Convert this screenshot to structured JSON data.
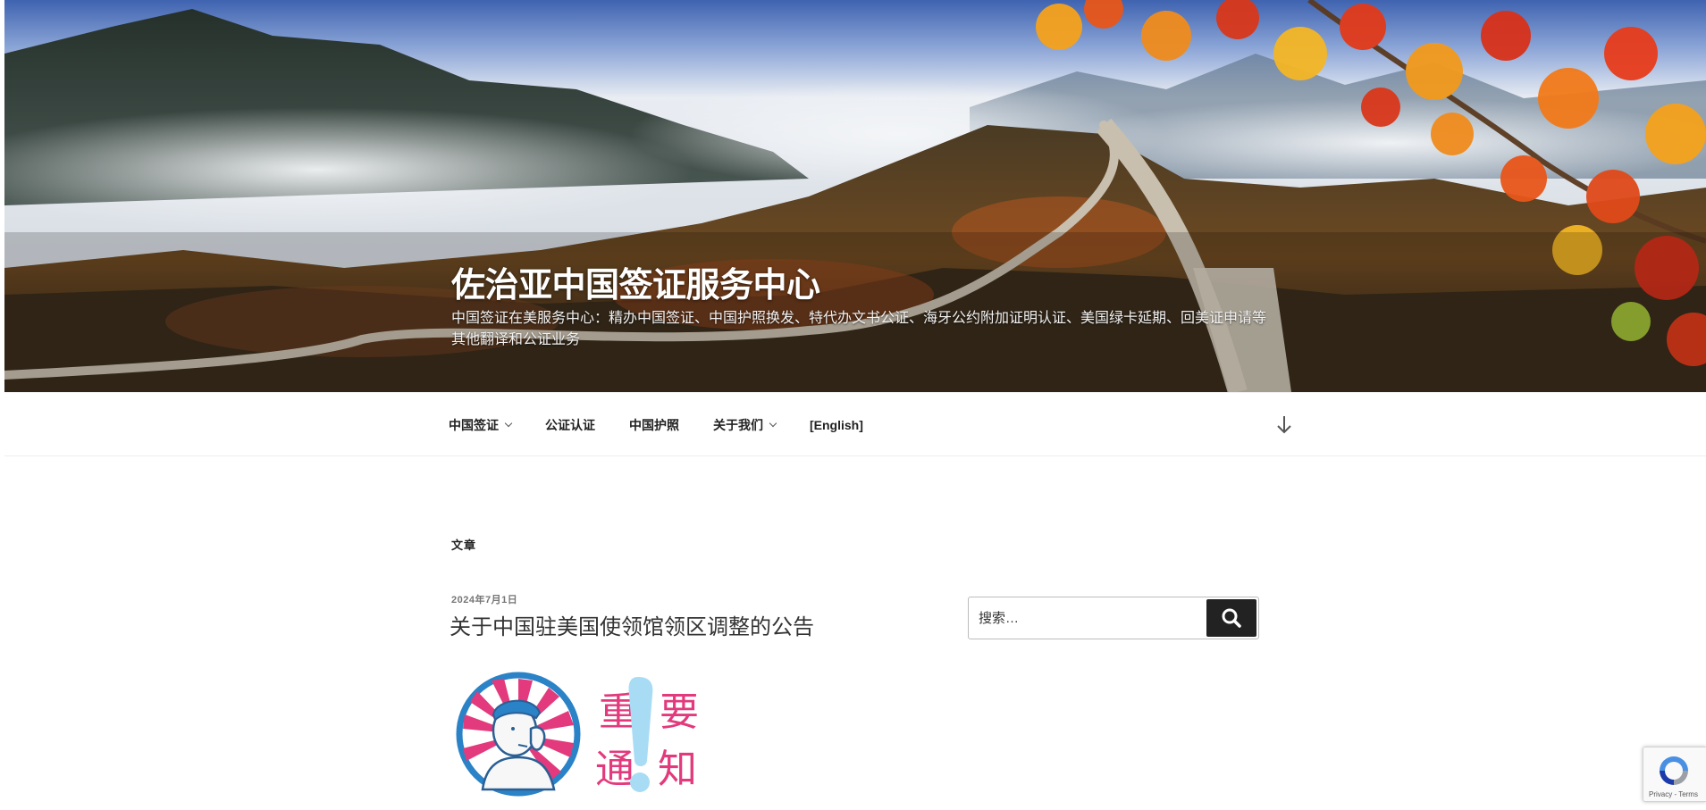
{
  "site": {
    "title": "佐治亚中国签证服务中心",
    "description": "中国签证在美服务中心：精办中国签证、中国护照换发、特代办文书公证、海牙公约附加证明认证、美国绿卡延期、回美证申请等其他翻译和公证业务"
  },
  "nav": {
    "items": [
      {
        "label": "中国签证",
        "has_submenu": true
      },
      {
        "label": "公证认证",
        "has_submenu": false
      },
      {
        "label": "中国护照",
        "has_submenu": false
      },
      {
        "label": "关于我们",
        "has_submenu": true
      },
      {
        "label": "[English]",
        "has_submenu": false
      }
    ],
    "scroll_icon": "arrow-down-icon"
  },
  "main": {
    "page_label": "文章",
    "post": {
      "date": "2024年7月1日",
      "title": "关于中国驻美国使领馆领区调整的公告",
      "image_text": {
        "c1": "重",
        "c2": "要",
        "c3": "通",
        "c4": "知"
      }
    }
  },
  "sidebar": {
    "search": {
      "placeholder": "搜索…",
      "button_icon": "search-icon"
    }
  },
  "recaptcha": {
    "text": "Privacy - Terms"
  },
  "colors": {
    "notice_pink": "#e23a7c",
    "notice_blue": "#2a82c7",
    "button_dark": "#222222"
  }
}
